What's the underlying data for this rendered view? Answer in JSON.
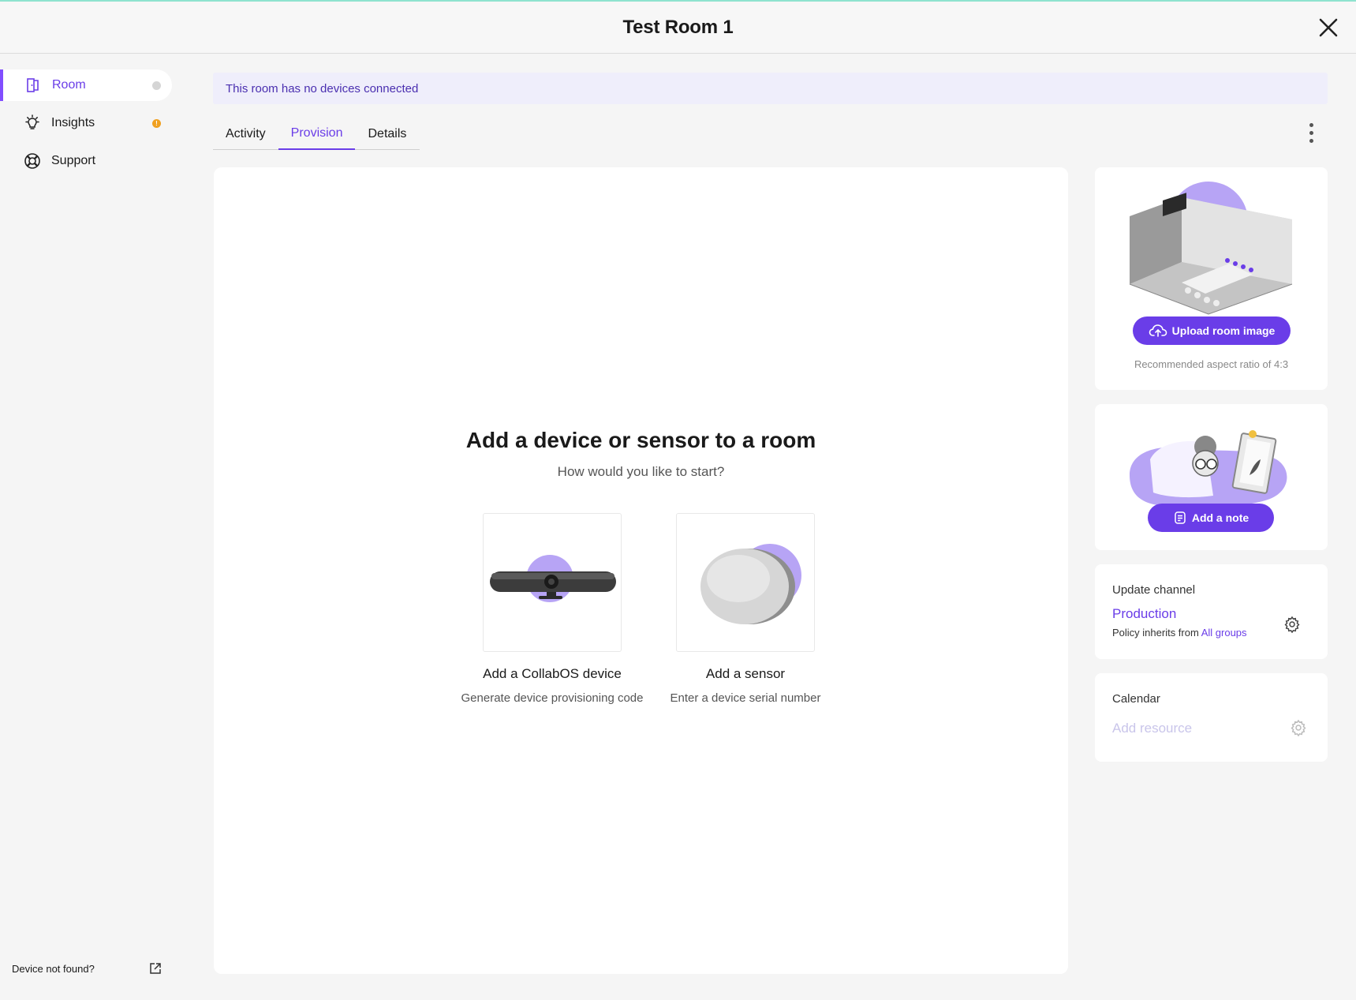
{
  "header": {
    "title": "Test Room 1"
  },
  "sidebar": {
    "items": [
      {
        "label": "Room"
      },
      {
        "label": "Insights"
      },
      {
        "label": "Support"
      }
    ],
    "footer_text": "Device not found?"
  },
  "banner": {
    "text": "This room has no devices connected"
  },
  "tabs": [
    {
      "label": "Activity"
    },
    {
      "label": "Provision"
    },
    {
      "label": "Details"
    }
  ],
  "main": {
    "title": "Add a device or sensor to a room",
    "subtitle": "How would you like to start?",
    "options": [
      {
        "label": "Add a CollabOS device",
        "description": "Generate device provisioning code"
      },
      {
        "label": "Add a sensor",
        "description": "Enter a device serial number"
      }
    ]
  },
  "room_image": {
    "button_label": "Upload room image",
    "hint": "Recommended aspect ratio of 4:3"
  },
  "note": {
    "button_label": "Add a note"
  },
  "update_channel": {
    "label": "Update channel",
    "value": "Production",
    "policy_prefix": "Policy inherits from",
    "policy_link": "All groups"
  },
  "calendar": {
    "label": "Calendar",
    "placeholder": "Add resource"
  },
  "colors": {
    "accent": "#6a3de8",
    "banner_bg": "#efeefb",
    "lavender": "#b7a4f5"
  },
  "icons": [
    "room-icon",
    "lightbulb-icon",
    "support-icon",
    "external-link-icon",
    "close-icon",
    "more-vert-icon",
    "cloud-upload-icon",
    "note-icon",
    "gear-icon"
  ]
}
